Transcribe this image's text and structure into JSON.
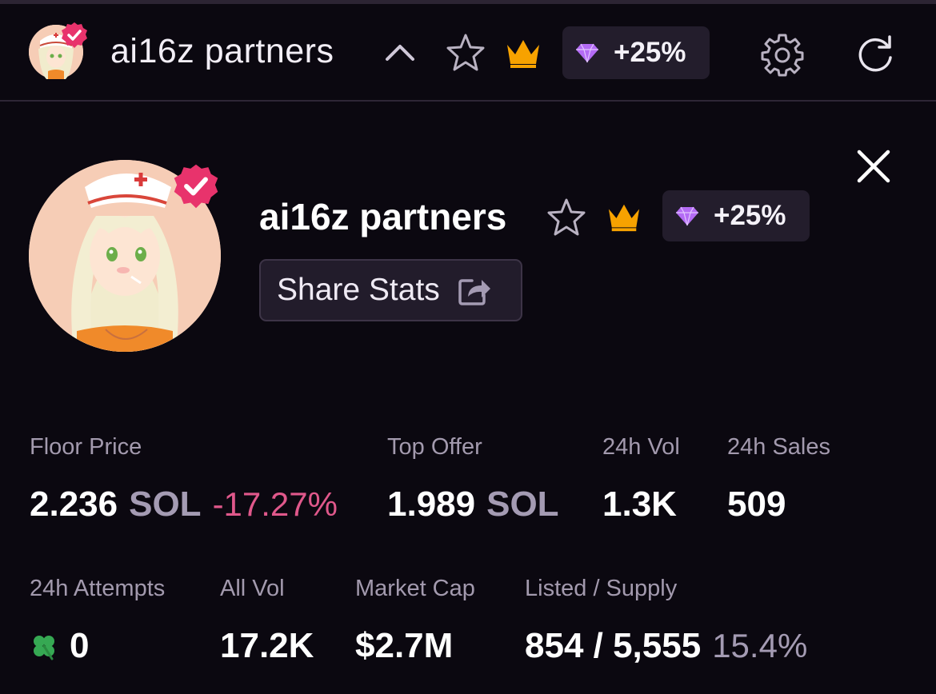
{
  "header": {
    "title": "ai16z partners",
    "boost_label": "+25%"
  },
  "detail": {
    "title": "ai16z partners",
    "boost_label": "+25%",
    "share_label": "Share Stats"
  },
  "stats": {
    "floor_price": {
      "label": "Floor Price",
      "value": "2.236",
      "unit": "SOL",
      "change": "-17.27%"
    },
    "top_offer": {
      "label": "Top Offer",
      "value": "1.989",
      "unit": "SOL"
    },
    "vol_24h": {
      "label": "24h Vol",
      "value": "1.3K"
    },
    "sales_24h": {
      "label": "24h Sales",
      "value": "509"
    },
    "attempts_24h": {
      "label": "24h Attempts",
      "value": "0"
    },
    "all_vol": {
      "label": "All Vol",
      "value": "17.2K"
    },
    "market_cap": {
      "label": "Market Cap",
      "value": "$2.7M"
    },
    "listed_supply": {
      "label": "Listed / Supply",
      "value": "854 / 5,555",
      "percent": "15.4%"
    }
  },
  "colors": {
    "background": "#0b0810",
    "verified_badge": "#e8336c",
    "crown": "#f7a200",
    "diamond": "#b46bf5",
    "negative": "#e0588b",
    "clover": "#36a853"
  },
  "icons": [
    "chevron-up-icon",
    "star-icon",
    "crown-icon",
    "diamond-icon",
    "gear-icon",
    "refresh-icon",
    "close-icon",
    "share-icon",
    "clover-icon",
    "verified-badge-icon"
  ]
}
